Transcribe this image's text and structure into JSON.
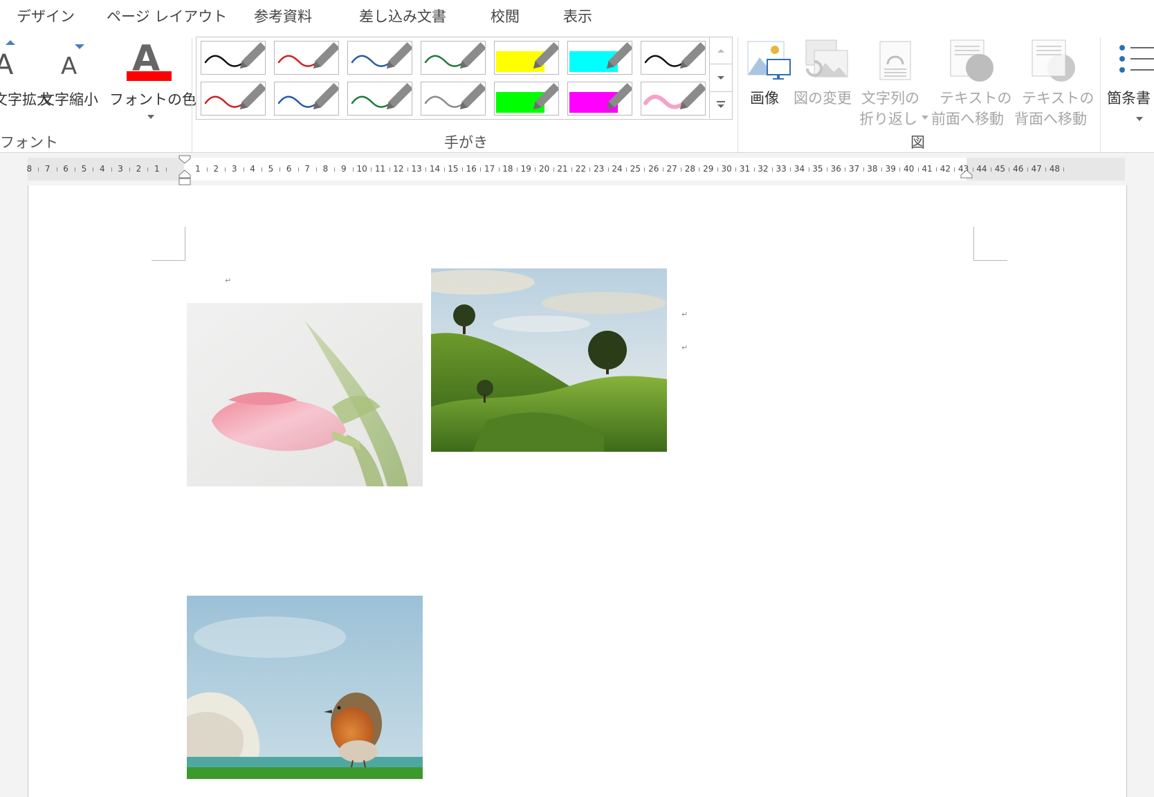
{
  "tabs": [
    "デザイン",
    "ページ レイアウト",
    "参考資料",
    "差し込み文書",
    "校閲",
    "表示"
  ],
  "font_group": {
    "label": "フォント",
    "grow_label": "文字拡大",
    "shrink_label": "文字縮小",
    "color_label": "フォントの色",
    "color": "#ff0000"
  },
  "ink_group": {
    "label": "手がき",
    "pens": [
      {
        "kind": "pen",
        "color": "#111111"
      },
      {
        "kind": "pen",
        "color": "#d42020"
      },
      {
        "kind": "pen",
        "color": "#2a5aa8"
      },
      {
        "kind": "pen",
        "color": "#1f7a3a"
      },
      {
        "kind": "highlighter",
        "color": "#ffff00"
      },
      {
        "kind": "highlighter",
        "color": "#00ffff"
      },
      {
        "kind": "pen",
        "color": "#111111"
      },
      {
        "kind": "pen",
        "color": "#d42020"
      },
      {
        "kind": "pen",
        "color": "#2a5aa8"
      },
      {
        "kind": "pen",
        "color": "#1f7a3a"
      },
      {
        "kind": "pen",
        "color": "#8a8a8a"
      },
      {
        "kind": "highlighter",
        "color": "#00ff00"
      },
      {
        "kind": "highlighter",
        "color": "#ff00ff"
      },
      {
        "kind": "pen",
        "color": "#f4a3c8"
      }
    ]
  },
  "figure_group": {
    "label": "図",
    "image_label": "画像",
    "change_image_label": "図の変更",
    "wrap_label_1": "文字列の",
    "wrap_label_2": "折り返し",
    "front_label_1": "テキストの",
    "front_label_2": "前面へ移動",
    "back_label_1": "テキストの",
    "back_label_2": "背面へ移動"
  },
  "bullets_label": "箇条書",
  "ruler": {
    "left_numbers": [
      "8",
      "7",
      "6",
      "5",
      "4",
      "3",
      "2",
      "1"
    ],
    "right_numbers": [
      "1",
      "2",
      "3",
      "4",
      "5",
      "6",
      "7",
      "8",
      "9",
      "10",
      "11",
      "12",
      "13",
      "14",
      "15",
      "16",
      "17",
      "18",
      "19",
      "20",
      "21",
      "22",
      "23",
      "24",
      "25",
      "26",
      "27",
      "28",
      "29",
      "30",
      "31",
      "32",
      "33",
      "34",
      "35",
      "36",
      "37",
      "38",
      "39",
      "40",
      "41",
      "42",
      "43",
      "44",
      "45",
      "46",
      "47",
      "48"
    ]
  },
  "document": {
    "paragraph_mark": "↵",
    "images": [
      {
        "name": "tulip-photo"
      },
      {
        "name": "hills-photo"
      },
      {
        "name": "robin-photo"
      }
    ]
  }
}
